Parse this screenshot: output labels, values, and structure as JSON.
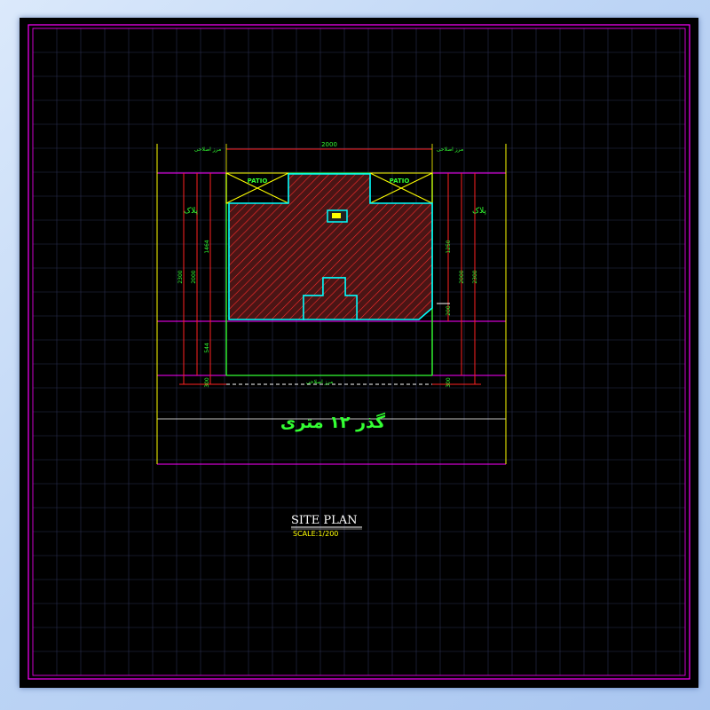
{
  "drawing": {
    "title": "SITE PLAN",
    "scale": "SCALE:1/200",
    "street_label": "گذر ۱۲ متری",
    "patio_labels": [
      "PATIO",
      "PATIO"
    ],
    "plak_labels": [
      "پلاک",
      "پلاک"
    ],
    "top_dimension": "2000",
    "top_side_labels": [
      "مرز اصلاحی",
      "مرز اصلاحی"
    ],
    "bottom_side_label": "مرز اصلاحی",
    "left_dimensions": [
      "2300",
      "2000",
      "1464",
      "544",
      "300"
    ],
    "right_dimensions": [
      "2300",
      "2000",
      "1250",
      "200",
      "300"
    ]
  },
  "colors": {
    "background": "#000000",
    "grid": "#2a3050",
    "border": "#ff00ff",
    "building_fill": "#5a1a1a",
    "building_hatch": "#ff2222",
    "building_outline": "#00ffff",
    "dimension_line": "#ff2222",
    "boundary": "#33ff33",
    "text": "#33ff33",
    "extension": "#ffff00"
  }
}
